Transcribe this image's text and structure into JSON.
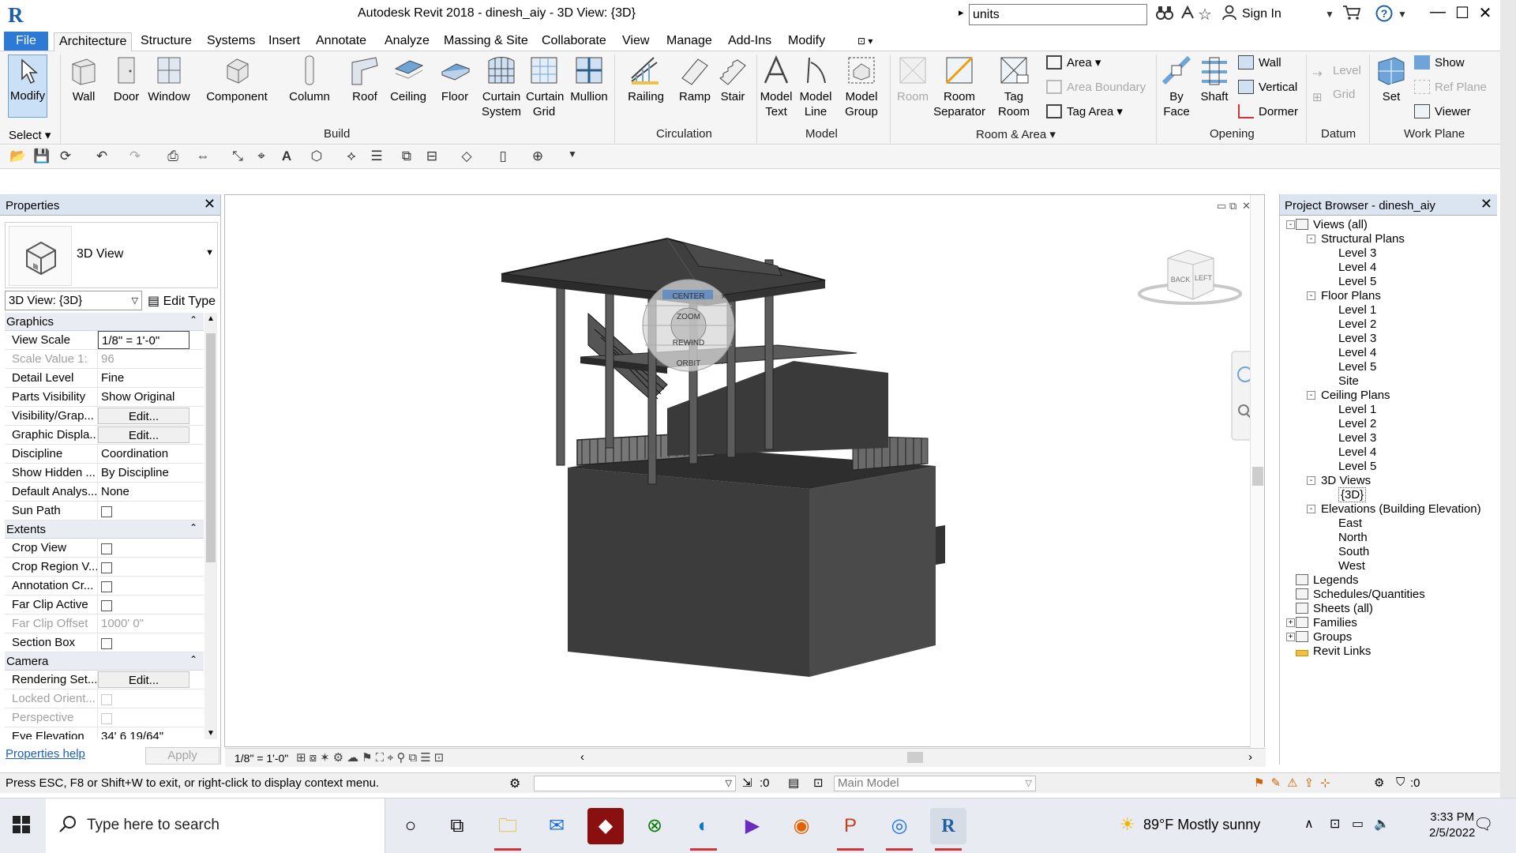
{
  "window": {
    "title": "Autodesk Revit 2018 -    dinesh_aiy - 3D View: {3D}",
    "search_value": "units",
    "sign_in": "Sign In"
  },
  "menu": {
    "file": "File",
    "tabs": [
      "Architecture",
      "Structure",
      "Systems",
      "Insert",
      "Annotate",
      "Analyze",
      "Massing & Site",
      "Collaborate",
      "View",
      "Manage",
      "Add-Ins",
      "Modify"
    ]
  },
  "ribbon": {
    "modify": "Modify",
    "select": "Select",
    "build": {
      "label": "Build",
      "items": [
        "Wall",
        "Door",
        "Window",
        "Component",
        "Column",
        "Roof",
        "Ceiling",
        "Floor",
        "Curtain System",
        "Curtain Grid",
        "Mullion"
      ]
    },
    "circulation": {
      "label": "Circulation",
      "items": [
        "Railing",
        "Ramp",
        "Stair"
      ]
    },
    "model": {
      "label": "Model",
      "items": [
        "Model Text",
        "Model Line",
        "Model Group"
      ]
    },
    "room_area": {
      "label": "Room & Area",
      "room": "Room",
      "room_separator": "Room Separator",
      "tag_room": "Tag Room",
      "area": "Area",
      "area_boundary": "Area  Boundary",
      "tag_area": "Tag  Area"
    },
    "opening": {
      "label": "Opening",
      "by_face": "By Face",
      "shaft": "Shaft",
      "wall": "Wall",
      "vertical": "Vertical",
      "dormer": "Dormer"
    },
    "datum": {
      "label": "Datum",
      "level": "Level",
      "grid": "Grid"
    },
    "work_plane": {
      "label": "Work Plane",
      "set": "Set",
      "show": "Show",
      "ref_plane": "Ref  Plane",
      "viewer": "Viewer"
    }
  },
  "properties": {
    "title": "Properties",
    "type_name": "3D View",
    "view_selector": "3D View: {3D}",
    "edit_type": "Edit Type",
    "categories": [
      {
        "name": "Graphics",
        "rows": [
          {
            "key": "View Scale",
            "value": "1/8\" = 1'-0\"",
            "kind": "boxed"
          },
          {
            "key": "Scale Value    1:",
            "value": "96",
            "kind": "disabled"
          },
          {
            "key": "Detail Level",
            "value": "Fine",
            "kind": "text"
          },
          {
            "key": "Parts Visibility",
            "value": "Show Original",
            "kind": "text"
          },
          {
            "key": "Visibility/Grap...",
            "value": "Edit...",
            "kind": "button"
          },
          {
            "key": "Graphic Displa...",
            "value": "Edit...",
            "kind": "button"
          },
          {
            "key": "Discipline",
            "value": "Coordination",
            "kind": "text"
          },
          {
            "key": "Show Hidden ...",
            "value": "By Discipline",
            "kind": "text"
          },
          {
            "key": "Default Analys...",
            "value": "None",
            "kind": "text"
          },
          {
            "key": "Sun Path",
            "value": "",
            "kind": "check"
          }
        ]
      },
      {
        "name": "Extents",
        "rows": [
          {
            "key": "Crop View",
            "value": "",
            "kind": "check"
          },
          {
            "key": "Crop Region V...",
            "value": "",
            "kind": "check"
          },
          {
            "key": "Annotation Cr...",
            "value": "",
            "kind": "check"
          },
          {
            "key": "Far Clip Active",
            "value": "",
            "kind": "check"
          },
          {
            "key": "Far Clip Offset",
            "value": "1000'  0\"",
            "kind": "disabled"
          },
          {
            "key": "Section Box",
            "value": "",
            "kind": "check"
          }
        ]
      },
      {
        "name": "Camera",
        "rows": [
          {
            "key": "Rendering Set...",
            "value": "Edit...",
            "kind": "button"
          },
          {
            "key": "Locked Orient...",
            "value": "",
            "kind": "check-disabled"
          },
          {
            "key": "Perspective",
            "value": "",
            "kind": "check-disabled"
          },
          {
            "key": "Eye Elevation",
            "value": "34'  6 19/64\"",
            "kind": "text"
          }
        ]
      }
    ],
    "help": "Properties help",
    "apply": "Apply"
  },
  "viewport": {
    "scale": "1/8\" = 1'-0\"",
    "view_cube": {
      "back": "BACK",
      "left": "LEFT"
    },
    "wheel": [
      "CENTER",
      "ZOOM",
      "REWIND",
      "ORBIT"
    ]
  },
  "browser": {
    "title": "Project Browser - dinesh_aiy",
    "tree": [
      {
        "label": "Views (all)",
        "level": 0,
        "expander": "-",
        "icon": "views-icon"
      },
      {
        "label": "Structural Plans",
        "level": 1,
        "expander": "-"
      },
      {
        "label": "Level 3",
        "level": 2
      },
      {
        "label": "Level 4",
        "level": 2
      },
      {
        "label": "Level 5",
        "level": 2
      },
      {
        "label": "Floor Plans",
        "level": 1,
        "expander": "-"
      },
      {
        "label": "Level 1",
        "level": 2
      },
      {
        "label": "Level 2",
        "level": 2
      },
      {
        "label": "Level 3",
        "level": 2
      },
      {
        "label": "Level 4",
        "level": 2
      },
      {
        "label": "Level 5",
        "level": 2
      },
      {
        "label": "Site",
        "level": 2
      },
      {
        "label": "Ceiling Plans",
        "level": 1,
        "expander": "-"
      },
      {
        "label": "Level 1",
        "level": 2
      },
      {
        "label": "Level 2",
        "level": 2
      },
      {
        "label": "Level 3",
        "level": 2
      },
      {
        "label": "Level 4",
        "level": 2
      },
      {
        "label": "Level 5",
        "level": 2
      },
      {
        "label": "3D Views",
        "level": 1,
        "expander": "-"
      },
      {
        "label": "{3D}",
        "level": 2,
        "selected": true
      },
      {
        "label": "Elevations (Building Elevation)",
        "level": 1,
        "expander": "-"
      },
      {
        "label": "East",
        "level": 2
      },
      {
        "label": "North",
        "level": 2
      },
      {
        "label": "South",
        "level": 2
      },
      {
        "label": "West",
        "level": 2
      },
      {
        "label": "Legends",
        "level": 0,
        "icon": "legends-icon"
      },
      {
        "label": "Schedules/Quantities",
        "level": 0,
        "icon": "schedules-icon"
      },
      {
        "label": "Sheets (all)",
        "level": 0,
        "icon": "sheets-icon"
      },
      {
        "label": "Families",
        "level": 0,
        "expander": "+",
        "icon": "families-icon"
      },
      {
        "label": "Groups",
        "level": 0,
        "expander": "+",
        "icon": "groups-icon"
      },
      {
        "label": "Revit Links",
        "level": 0,
        "icon": "links-icon"
      }
    ]
  },
  "status": {
    "message": "Press ESC, F8 or Shift+W to exit, or right-click to display context menu.",
    "selection_count": ":0",
    "workset": "Main Model",
    "filter_count": ":0"
  },
  "taskbar": {
    "search_placeholder": "Type here to search",
    "weather": "89°F  Mostly sunny",
    "time": "3:33 PM",
    "date": "2/5/2022"
  },
  "colors": {
    "accent": "#2d7ad6",
    "ribbon": "#f5f5f5",
    "panel_header": "#dbe5f1",
    "model_dark": "#3a3a3a"
  }
}
